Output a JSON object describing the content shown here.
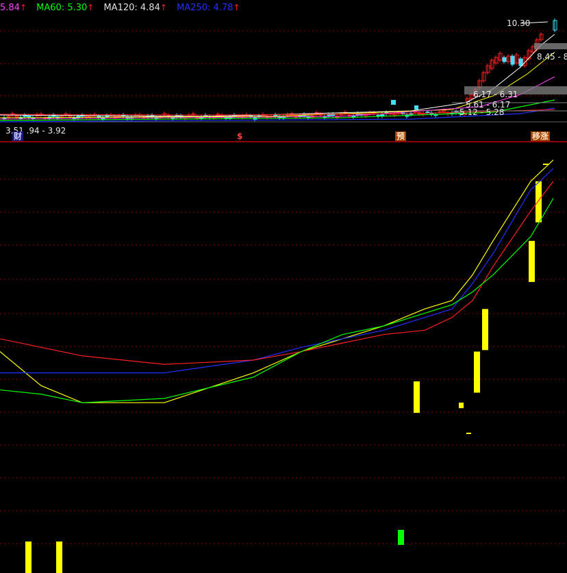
{
  "colors": {
    "background": "#000000",
    "divider": "#c00000",
    "grid": "#8b0000",
    "yellow": "#ffff00",
    "green": "#00ff00",
    "red": "#ff2020",
    "cyan": "#40e0ff",
    "blue": "#2030ff",
    "white": "#ffffff",
    "magenta": "#ff40ff",
    "gray": "#a0a0a0"
  },
  "ma_legend": [
    {
      "label": "5.84",
      "color": "#ff40ff",
      "arrow": "↑"
    },
    {
      "label": "MA60: 5.30",
      "color": "#00ff00",
      "arrow": "↑"
    },
    {
      "label": "MA120: 4.84",
      "color": "#e0e0e0",
      "arrow": "↑"
    },
    {
      "label": "MA250: 4.78",
      "color": "#2030ff",
      "arrow": "↑"
    }
  ],
  "price_labels": {
    "high": "10.30",
    "range1": "8.45 - 8",
    "range2": "6.17 - 6.31",
    "range3": "5.61 - 6.17",
    "range4": "5.12 - 5.28",
    "low": "3.51  .94 - 3.92"
  },
  "event_tags": [
    {
      "text": "财",
      "color": "#c8c8ff",
      "bg": "#1a1a7a"
    },
    {
      "text": "$",
      "color": "#ff4040",
      "bg": "#000000"
    },
    {
      "text": "预",
      "color": "#ffe0c0",
      "bg": "#a04000"
    },
    {
      "text": "移涨",
      "color": "#ffe0c0",
      "bg": "#a04000"
    }
  ],
  "chart_data": [
    {
      "type": "candlestick",
      "title": "",
      "series": [
        {
          "name": "MA60",
          "value": 5.3
        },
        {
          "name": "MA120",
          "value": 4.84
        },
        {
          "name": "MA250",
          "value": 4.78
        }
      ],
      "annotations": [
        "10.30",
        "8.45 - 8",
        "6.17 - 6.31",
        "5.61 - 6.17",
        "5.12 - 5.28",
        "3.51",
        ".94 - 3.92"
      ]
    },
    {
      "type": "line",
      "title": "",
      "bars_up": [
        0.08,
        0.14,
        0.45,
        0.4,
        0.52,
        0.62,
        0.78,
        0.92
      ],
      "bars_down": [
        0.32
      ],
      "series": [
        {
          "color": "#ffff00",
          "values": [
            0.52,
            0.44,
            0.4,
            0.4,
            0.47,
            0.52,
            0.55,
            0.58,
            0.62,
            0.64,
            0.7,
            0.78,
            0.92,
            0.97
          ]
        },
        {
          "color": "#2030ff",
          "values": [
            0.47,
            0.47,
            0.47,
            0.47,
            0.5,
            0.53,
            0.55,
            0.57,
            0.6,
            0.62,
            0.68,
            0.75,
            0.9,
            0.95
          ]
        },
        {
          "color": "#ff2020",
          "values": [
            0.55,
            0.53,
            0.51,
            0.49,
            0.5,
            0.52,
            0.54,
            0.56,
            0.57,
            0.6,
            0.64,
            0.72,
            0.85,
            0.92
          ]
        },
        {
          "color": "#00ff00",
          "values": [
            0.43,
            0.42,
            0.4,
            0.41,
            0.46,
            0.52,
            0.56,
            0.58,
            0.61,
            0.63,
            0.66,
            0.7,
            0.79,
            0.88
          ]
        }
      ]
    }
  ]
}
